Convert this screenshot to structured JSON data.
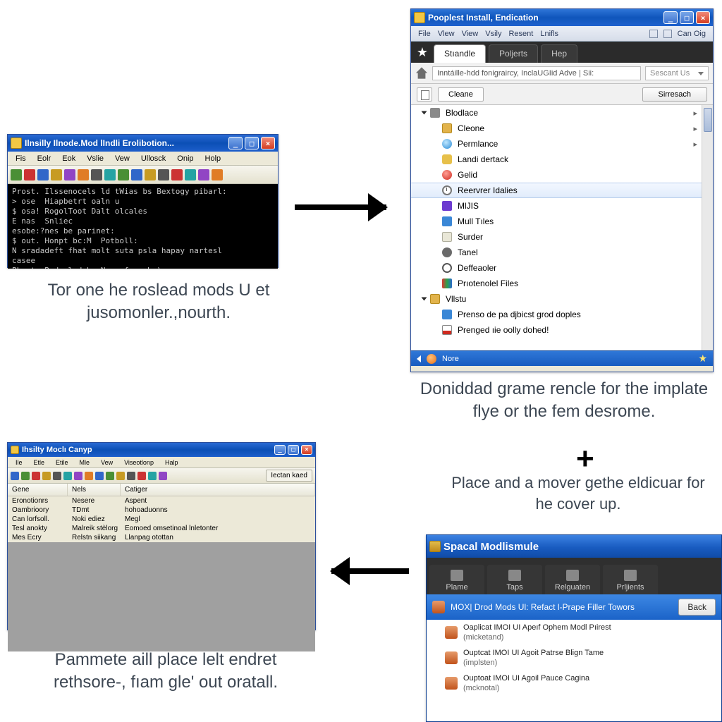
{
  "win_term": {
    "title": "Ilnsilly Ilnode.Mod lIndli Erolibotion...",
    "menu": [
      "Fis",
      "Eolr",
      "Eok",
      "Vslie",
      "Vew",
      "Ullosck",
      "Onip",
      "Holp"
    ],
    "console": "Prost. Ilssenocels ld tWias bs Bextogy pibarl:\n> ose  Hiapbetrt oaln u\n$ osa! RogolToot Dalt olcales\nE nas  Snliec\nesobe:?nes be parinet:\n$ out. Honpt bc:M  Potboll:\nN sradadeft fhat molt suta psla hapay nartesl\ncasee\nPLast. Rode.lod by Nare fparsho)\nOlorx: DeholstSetobo|"
  },
  "caption1": "Tor one he roslead mods U et jusomonler.,nourth.",
  "win_edu": {
    "title": "Pooplest Install, Endication",
    "sub_menu": [
      "File",
      "Vlew",
      "View",
      "Vsily",
      "Resent",
      "Lnifls"
    ],
    "right_label": "Can Oig",
    "tabs": [
      "Stıandle",
      "Poljerts",
      "Hep"
    ],
    "addr": "Inntáille-hdd fonigraircy, InclaUGIid Adve  |  Sii:",
    "combo": "Sescant Us",
    "clean": "Cleane",
    "sireach": "Sirresach",
    "tree": [
      {
        "txt": "Blodlace",
        "ico": "doc",
        "indent": 1,
        "tri": "open",
        "chev": true
      },
      {
        "txt": "Cleone",
        "ico": "fold",
        "indent": 2,
        "chev": true
      },
      {
        "txt": "Permlance",
        "ico": "globe",
        "indent": 2,
        "chev": true
      },
      {
        "txt": "Landi dertack",
        "ico": "therm",
        "indent": 2
      },
      {
        "txt": "Gelid",
        "ico": "red",
        "indent": 2
      },
      {
        "txt": "Reervrer Idalies",
        "ico": "clock",
        "indent": 2,
        "sel": true
      },
      {
        "txt": "MlJIS",
        "ico": "crown",
        "indent": 2
      },
      {
        "txt": "Mull Tıles",
        "ico": "page",
        "indent": 2
      },
      {
        "txt": "Surder",
        "ico": "clip",
        "indent": 2
      },
      {
        "txt": "Tanel",
        "ico": "cog",
        "indent": 2
      },
      {
        "txt": "Deffeaoler",
        "ico": "ring",
        "indent": 2
      },
      {
        "txt": "Prıotenolel Files",
        "ico": "colors",
        "indent": 2
      },
      {
        "txt": "Vllstu",
        "ico": "fold",
        "indent": 1,
        "tri": "open"
      },
      {
        "txt": "Prenso de pa djbicst grod doples",
        "ico": "page",
        "indent": 2
      },
      {
        "txt": "Prenged ıie oolly dohed!",
        "ico": "chart",
        "indent": 2
      }
    ],
    "footer": "Nore"
  },
  "caption2": "Doniddad grame rencle for the implate flye or the fem desrome.",
  "caption3": "Place and a mover gethe eldicuar for he cover up.",
  "win_table": {
    "title": "Ihsilty Moclı Canyp",
    "menu": [
      "Ile",
      "Etle",
      "Etile",
      "Mle",
      "Vew",
      "Viseotlonp",
      "Halp"
    ],
    "tool_end": "Iectan kaed",
    "headers": [
      "Gene",
      "Nels",
      "Catiger"
    ],
    "rows": [
      [
        "Eronotionrs",
        "Nesere",
        "Aspent"
      ],
      [
        "Oambrioory",
        "TDmt",
        "hohoaduonns"
      ],
      [
        "Can lorfsoll.",
        "Noki  ediez",
        "Megl"
      ],
      [
        "Tesl anokty",
        "Malreik stèlorg",
        "Eomoed omsetinoal lnletonter"
      ],
      [
        "Mes Ecry",
        "Relstn siikang",
        "Llanpag otottan"
      ]
    ]
  },
  "caption4": "Pammete aill place lelt endret rethsore-, fıam gle' out oratall.",
  "win_mod": {
    "title": "Spacal Modlismule",
    "tabs": [
      "Plame",
      "Taps",
      "Relguaten",
      "Prljients"
    ],
    "selrow": "MOX| Drod Mods Ul: Refact l-Prape Filler Towors",
    "back": "Back",
    "rows": [
      {
        "t": "Oaplicat IMOI UI Apeıf Ophem Modl Pıirest",
        "s": "(micketand)"
      },
      {
        "t": "Ouptcat IMOI UI Agoit Patrse Blign Tame",
        "s": "(implsten)"
      },
      {
        "t": "Ouptoat IMOI UI Agoil Pauce Cagina",
        "s": "(mcknotal)"
      }
    ]
  }
}
